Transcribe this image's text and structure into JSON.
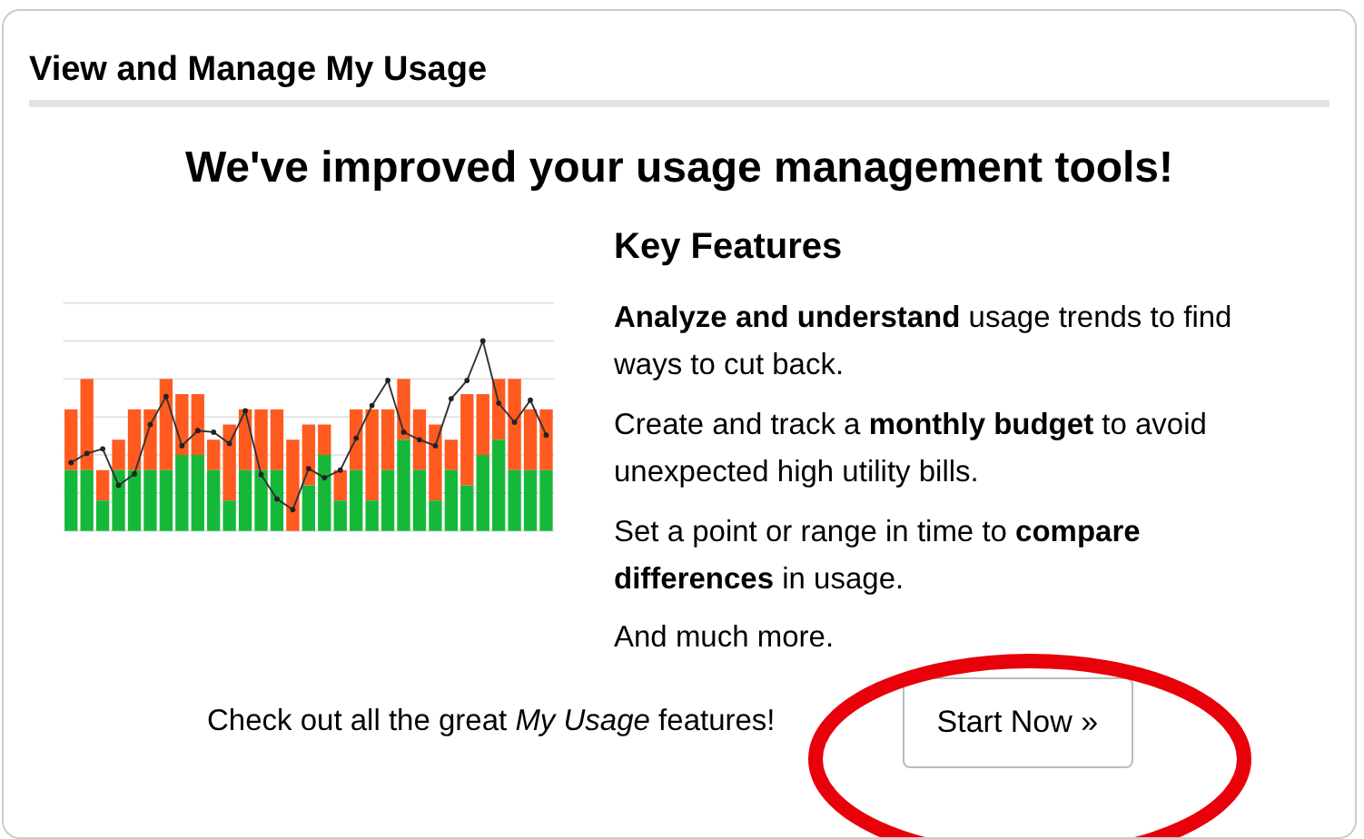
{
  "panel": {
    "title": "View and Manage My Usage"
  },
  "headline": "We've improved your usage management tools!",
  "features": {
    "title": "Key Features",
    "items": [
      "**Analyze and understand** usage trends to find ways to cut back.",
      "Create and track a **monthly budget** to avoid unexpected high utility bills.",
      "Set a point or range in time to **compare differences** in usage.",
      "And much more."
    ]
  },
  "footer": {
    "text": "Check out all the great *My Usage* features!",
    "button": "Start Now »"
  }
}
